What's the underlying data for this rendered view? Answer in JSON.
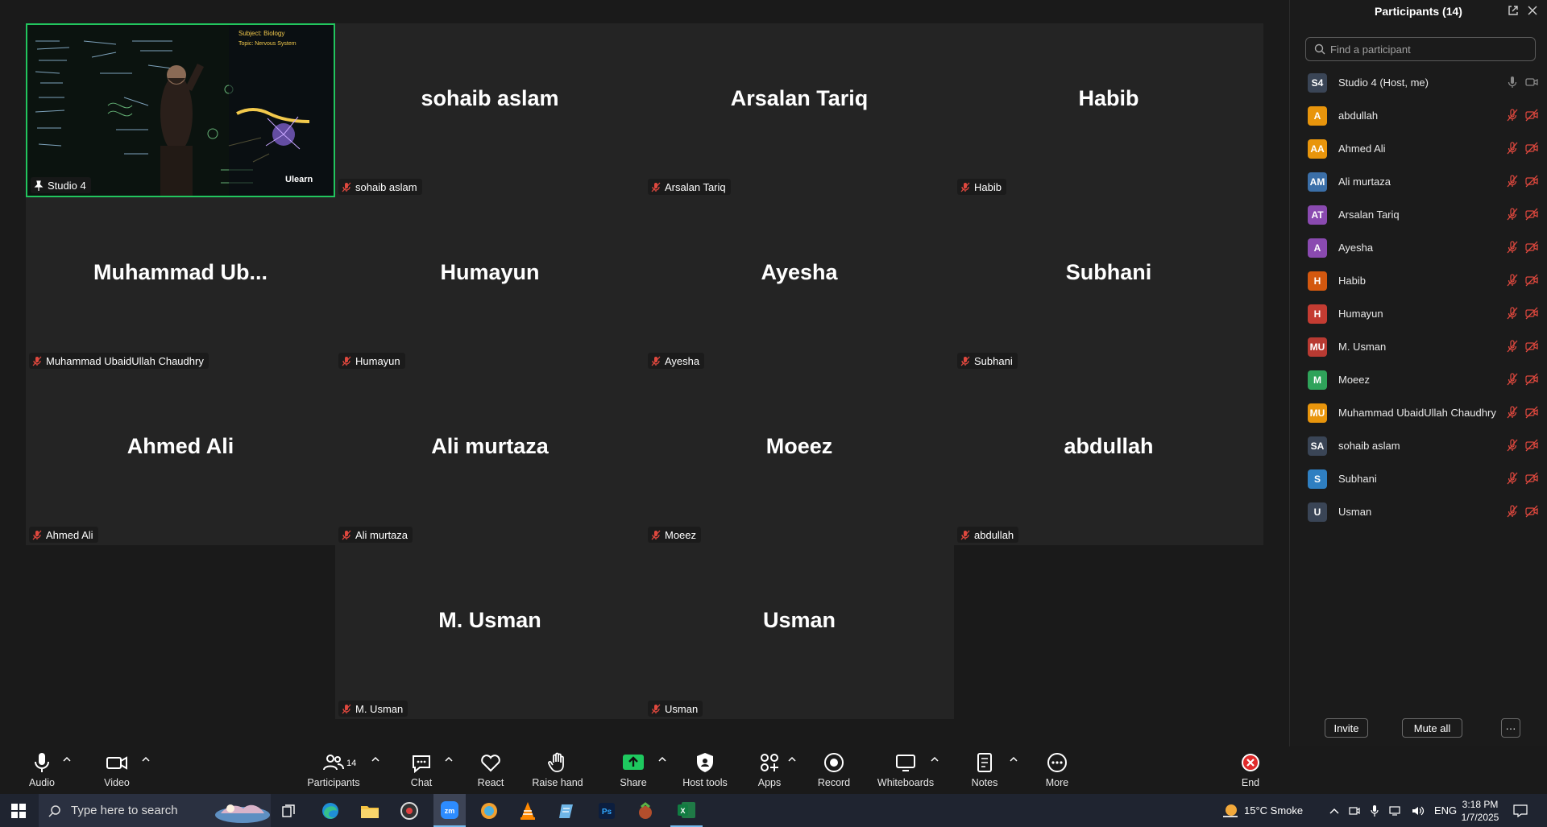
{
  "gallery": {
    "active": {
      "name_tag": "Studio 4",
      "board_header": "Subject: Biology",
      "board_topic": "Topic: Nervous System",
      "logo": "Ulearn"
    },
    "tiles": [
      {
        "big": "sohaib aslam",
        "tag": "sohaib aslam"
      },
      {
        "big": "Arsalan Tariq",
        "tag": "Arsalan Tariq"
      },
      {
        "big": "Habib",
        "tag": "Habib"
      },
      {
        "big": "Muhammad  Ub...",
        "tag": "Muhammad UbaidUllah Chaudhry"
      },
      {
        "big": "Humayun",
        "tag": "Humayun"
      },
      {
        "big": "Ayesha",
        "tag": "Ayesha"
      },
      {
        "big": "Subhani",
        "tag": "Subhani"
      },
      {
        "big": "Ahmed Ali",
        "tag": "Ahmed Ali"
      },
      {
        "big": "Ali murtaza",
        "tag": "Ali murtaza"
      },
      {
        "big": "Moeez",
        "tag": "Moeez"
      },
      {
        "big": "abdullah",
        "tag": "abdullah"
      },
      {
        "big": "M. Usman",
        "tag": "M. Usman"
      },
      {
        "big": "Usman",
        "tag": "Usman"
      }
    ]
  },
  "panel": {
    "title": "Participants (14)",
    "search_placeholder": "Find a participant",
    "participants": [
      {
        "initials": "S4",
        "name": "Studio 4 (Host, me)",
        "color": "#3a4556",
        "host": true
      },
      {
        "initials": "A",
        "name": "abdullah",
        "color": "#e8950c"
      },
      {
        "initials": "AA",
        "name": "Ahmed Ali",
        "color": "#e8950c"
      },
      {
        "initials": "AM",
        "name": "Ali murtaza",
        "color": "#3b6fa8"
      },
      {
        "initials": "AT",
        "name": "Arsalan Tariq",
        "color": "#8a4ab0"
      },
      {
        "initials": "A",
        "name": "Ayesha",
        "color": "#8a4ab0"
      },
      {
        "initials": "H",
        "name": "Habib",
        "color": "#d3580f"
      },
      {
        "initials": "H",
        "name": "Humayun",
        "color": "#c43c32"
      },
      {
        "initials": "MU",
        "name": "M. Usman",
        "color": "#b83a32"
      },
      {
        "initials": "M",
        "name": "Moeez",
        "color": "#2fa35a"
      },
      {
        "initials": "MU",
        "name": "Muhammad UbaidUllah Chaudhry",
        "color": "#e8950c"
      },
      {
        "initials": "SA",
        "name": "sohaib aslam",
        "color": "#3a4556"
      },
      {
        "initials": "S",
        "name": "Subhani",
        "color": "#2f7fc1"
      },
      {
        "initials": "U",
        "name": "Usman",
        "color": "#3a4556"
      }
    ],
    "invite_label": "Invite",
    "mute_all_label": "Mute all",
    "more_label": "···"
  },
  "toolbar": {
    "audio": "Audio",
    "video": "Video",
    "participants": "Participants",
    "participants_count": "14",
    "chat": "Chat",
    "react": "React",
    "raise_hand": "Raise hand",
    "share": "Share",
    "host_tools": "Host tools",
    "apps": "Apps",
    "record": "Record",
    "whiteboards": "Whiteboards",
    "notes": "Notes",
    "more": "More",
    "end": "End"
  },
  "taskbar": {
    "search_placeholder": "Type here to search",
    "weather": "15°C  Smoke",
    "lang": "ENG",
    "time": "3:18 PM",
    "date": "1/7/2025"
  },
  "colors": {
    "accent_green": "#22c55e",
    "muted_red": "#e0483e",
    "end_red": "#e02b2b",
    "share_green": "#1ec95f"
  }
}
